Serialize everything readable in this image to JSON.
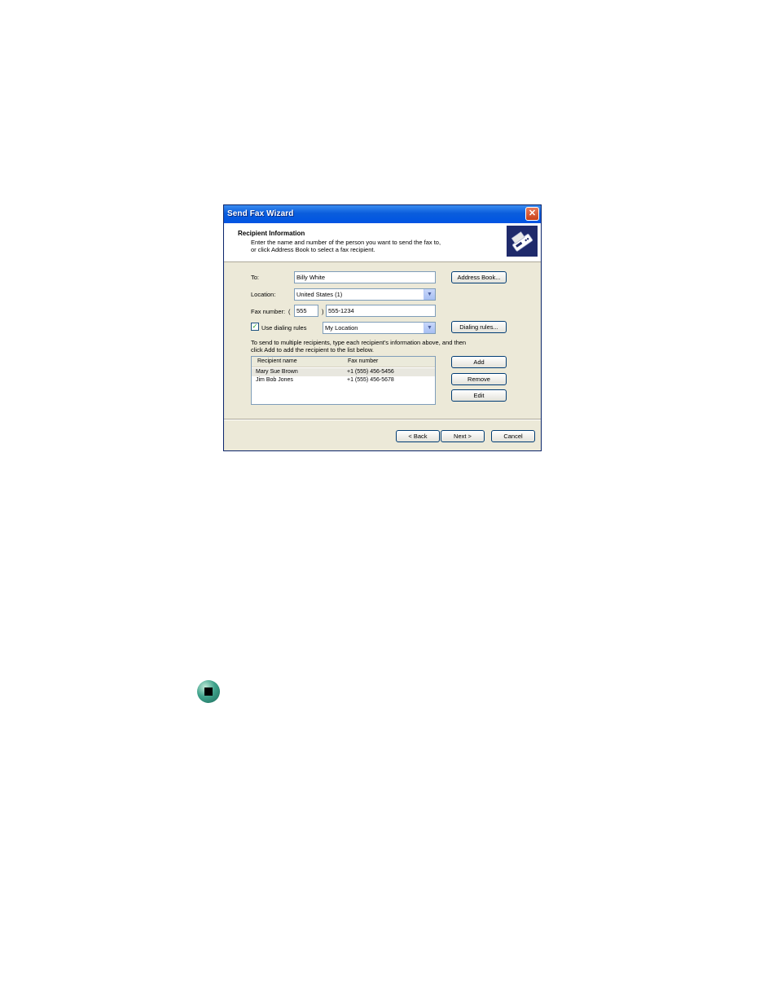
{
  "window": {
    "title": "Send Fax Wizard",
    "close_glyph": "✕"
  },
  "header": {
    "title": "Recipient Information",
    "description_line1": "Enter the name and number of the person you want to send the fax to,",
    "description_line2": "or click Address Book to select a fax recipient.",
    "icon": "fax-machine-icon"
  },
  "form": {
    "to_label": "To:",
    "to_value": "Billy White",
    "location_label": "Location:",
    "location_value": "United States (1)",
    "fax_number_label": "Fax number:",
    "paren_open": "(",
    "paren_close": ")",
    "area_code": "555",
    "number": "555-1234",
    "use_dialing_rules_label": "Use dialing rules",
    "use_dialing_rules_checked": true,
    "dialing_location": "My Location",
    "multi_note_line1": "To send to multiple recipients, type each recipient's information above, and then",
    "multi_note_line2": "click Add to add the recipient to the list below."
  },
  "buttons": {
    "address_book": "Address Book...",
    "dialing_rules": "Dialing rules...",
    "add": "Add",
    "remove": "Remove",
    "edit": "Edit",
    "back": "< Back",
    "next": "Next >",
    "cancel": "Cancel"
  },
  "recipients": {
    "columns": [
      "Recipient name",
      "Fax number"
    ],
    "rows": [
      {
        "name": "Mary Sue Brown",
        "fax": "+1 (555) 456-5456"
      },
      {
        "name": "Jim Bob Jones",
        "fax": "+1 (555) 456-5678"
      }
    ]
  },
  "colors": {
    "titlebar": "#0054e3",
    "dialog_bg": "#ece9d8",
    "bullet": "#3fa28b"
  }
}
